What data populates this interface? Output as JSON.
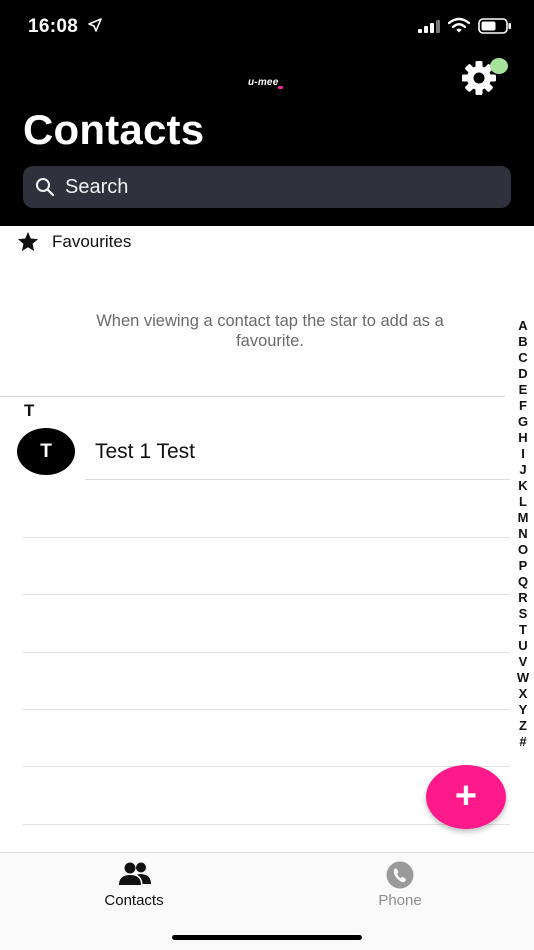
{
  "status_bar": {
    "time": "16:08",
    "icons": [
      "location-arrow-icon",
      "signal-icon",
      "wifi-icon",
      "battery-icon"
    ]
  },
  "header": {
    "logo_text": "u-mee",
    "title": "Contacts",
    "settings_icon": "gear-icon",
    "status_indicator_color": "#a6e39a"
  },
  "search": {
    "placeholder": "Search",
    "icon": "search-icon"
  },
  "favourites": {
    "icon": "star-icon",
    "label": "Favourites",
    "hint": "When viewing a contact tap the star to add as a favourite."
  },
  "contacts": {
    "sections": [
      {
        "letter": "T",
        "items": [
          {
            "initial": "T",
            "name": "Test 1 Test"
          }
        ]
      }
    ]
  },
  "alphabet_index": [
    "A",
    "B",
    "C",
    "D",
    "E",
    "F",
    "G",
    "H",
    "I",
    "J",
    "K",
    "L",
    "M",
    "N",
    "O",
    "P",
    "Q",
    "R",
    "S",
    "T",
    "U",
    "V",
    "W",
    "X",
    "Y",
    "Z",
    "#"
  ],
  "fab": {
    "icon": "plus-icon",
    "label": "+",
    "color": "#ff1a8c"
  },
  "tab_bar": {
    "tabs": [
      {
        "label": "Contacts",
        "icon": "contacts-icon",
        "active": true
      },
      {
        "label": "Phone",
        "icon": "phone-icon",
        "active": false
      }
    ]
  },
  "colors": {
    "header_bg": "#000000",
    "search_bg": "#2f323c",
    "accent": "#ff1a8c",
    "inactive_tab": "#8e8e8e"
  }
}
